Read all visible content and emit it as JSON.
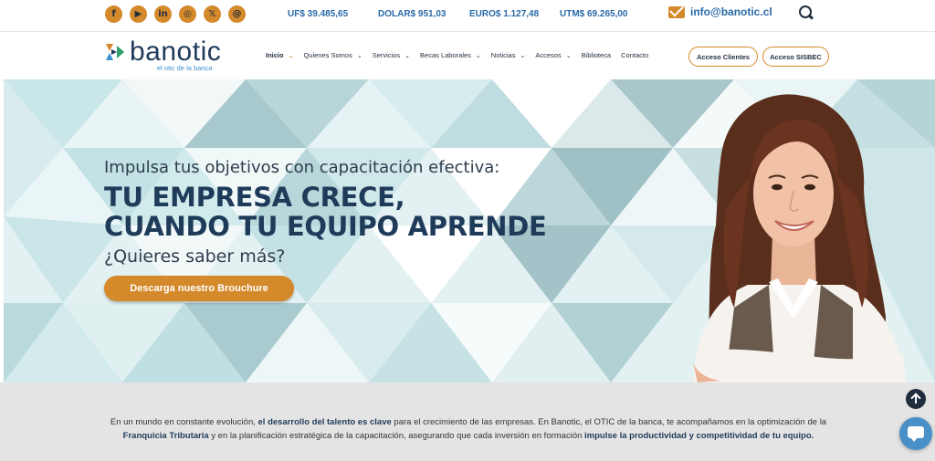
{
  "topbar": {
    "social": [
      {
        "icon": "facebook-icon",
        "glyph": "f"
      },
      {
        "icon": "youtube-icon",
        "glyph": "▶"
      },
      {
        "icon": "linkedin-icon",
        "glyph": "in"
      },
      {
        "icon": "instagram-icon",
        "glyph": "◎"
      },
      {
        "icon": "x-icon",
        "glyph": "𝕏"
      },
      {
        "icon": "threads-icon",
        "glyph": "@"
      }
    ],
    "rates": {
      "uf": "UF$ 39.485,65",
      "dolar": "DOLAR$ 951,03",
      "euro": "EURO$ 1.127,48",
      "utm": "UTM$ 69.265,00"
    },
    "email": "info@banotic.cl"
  },
  "nav": {
    "logo_word": "banotic",
    "logo_tagline": "el otic de la banca",
    "items": [
      {
        "label": "Inicio",
        "has_dropdown": true
      },
      {
        "label": "Quienes Somos",
        "has_dropdown": true
      },
      {
        "label": "Servicios",
        "has_dropdown": true
      },
      {
        "label": "Becas Laborales",
        "has_dropdown": true
      },
      {
        "label": "Noticias",
        "has_dropdown": true
      },
      {
        "label": "Accesos",
        "has_dropdown": true
      },
      {
        "label": "Biblioteca",
        "has_dropdown": false
      },
      {
        "label": "Contacto",
        "has_dropdown": false
      }
    ],
    "btn_clientes": "Acceso Clientes",
    "btn_sisbec": "Acceso SISBEC"
  },
  "hero": {
    "kicker": "Impulsa tus objetivos con capacitación efectiva:",
    "headline_1": "TU EMPRESA CRECE,",
    "headline_2": "CUANDO TU EQUIPO APRENDE",
    "question": "¿Quieres saber más?",
    "cta": "Descarga nuestro Brouchure"
  },
  "intro": {
    "p1": "En un mundo en constante evolución, ",
    "b1": "el desarrollo del talento es clave",
    "p2": " para el crecimiento de las empresas. En Banotic, el OTIC de la banca, te acompañamos en la optimización de la ",
    "b2": "Franquicia Tributaria",
    "p3": " y en la planificación estratégica de la capacitación, asegurando que cada inversión en formación ",
    "b3": "impulse la productividad y competitividad de tu equipo."
  },
  "colors": {
    "accent": "#d4892a",
    "brand_dark": "#1f3b5a",
    "rate_blue": "#2b6aa8"
  }
}
